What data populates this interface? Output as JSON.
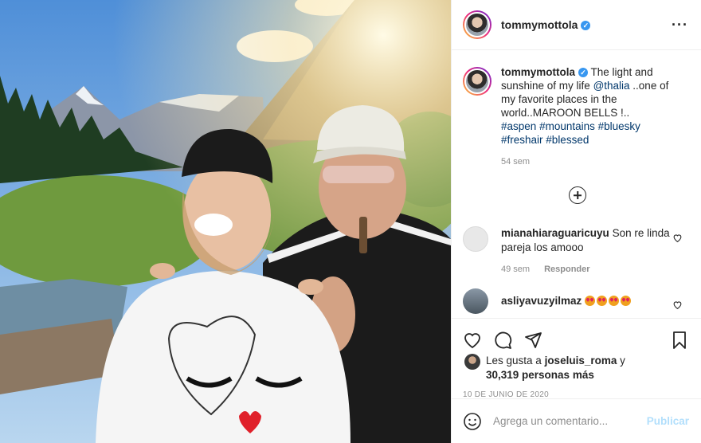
{
  "post": {
    "username": "tommymottola",
    "verified_mark": "✓",
    "more_icon": "more-horizontal-icon",
    "photo_alt": ""
  },
  "caption": {
    "username": "tommymottola",
    "text_before": " The light and sunshine of my life ",
    "mention": "@thalia",
    "text_after": " ..one of my favorite places in the world..MAROON BELLS !..",
    "hashtags": [
      "#aspen",
      "#mountains",
      "#bluesky",
      "#freshair",
      "#blessed"
    ],
    "time": "54 sem"
  },
  "comments": [
    {
      "username": "mianahiaraguaricuyu",
      "text": "Son re linda pareja los amooo",
      "time": "49 sem",
      "reply_label": "Responder",
      "avatar_color": "#e8e8e8"
    },
    {
      "username": "asliyavuzyilmaz",
      "emoji_count": 4,
      "avatar_color": "#6b7b88"
    }
  ],
  "likes": {
    "prefix": "Les gusta a ",
    "first_user": "joseluis_roma",
    "middle": " y",
    "count": "30,319 personas más"
  },
  "date": "10 DE JUNIO DE 2020",
  "add_comment": {
    "placeholder": "Agrega un comentario...",
    "publish_label": "Publicar"
  },
  "colors": {
    "link": "#00376b",
    "muted": "#8e8e8e",
    "verified": "#3897f0",
    "publish_disabled": "#b2dffc",
    "border": "#efefef"
  }
}
